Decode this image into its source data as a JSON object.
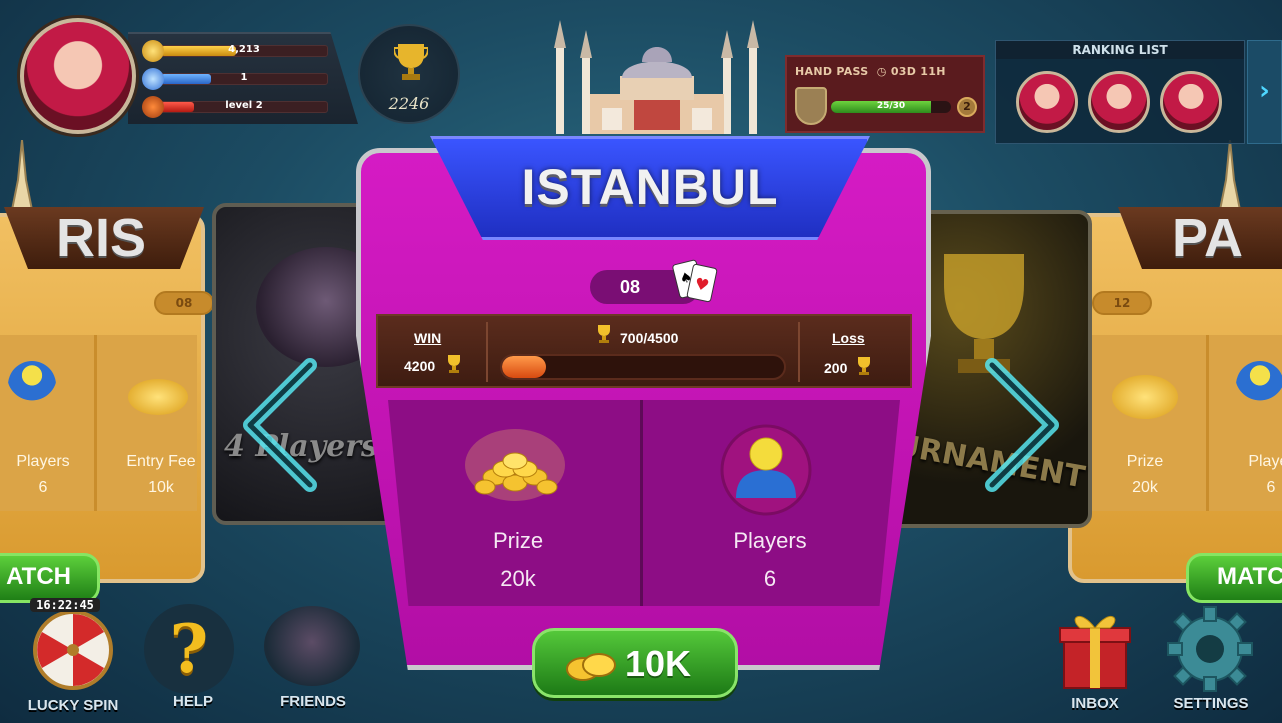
{
  "profile": {
    "coins": "4,213",
    "gems": "1",
    "level": "level 2",
    "coins_fill": 0.45,
    "gems_fill": 0.3,
    "level_fill": 0.2,
    "trophies": "2246"
  },
  "hand_pass": {
    "title": "HAND PASS",
    "timer": "03D 11H",
    "progress_text": "25/30",
    "progress_fraction": 0.83,
    "level": "2"
  },
  "ranking": {
    "title": "RANKING LIST",
    "next_icon": "›"
  },
  "left_card": {
    "banner_text": "RIS",
    "count": "08",
    "players_label": "Players",
    "players_value": "6",
    "entry_fee_label": "Entry Fee",
    "entry_fee_value": "10k",
    "match_label": "ATCH",
    "mode_text": "4 Players"
  },
  "right_card": {
    "banner_text": "PA",
    "count": "12",
    "prize_label": "Prize",
    "prize_value": "20k",
    "players_label": "Player",
    "players_value": "6",
    "match_label": "MATC",
    "mode_text": "URNAMENT"
  },
  "modal": {
    "title": "ISTANBUL",
    "count": "08",
    "win_label": "WIN",
    "win_value": "4200",
    "progress_text": "700/4500",
    "progress_fraction": 0.155,
    "loss_label": "Loss",
    "loss_value": "200",
    "prize_label": "Prize",
    "prize_value": "20k",
    "players_label": "Players",
    "players_value": "6",
    "join_label": "10K"
  },
  "bottom_nav": {
    "lucky_spin": "LUCKY SPIN",
    "lucky_spin_timer": "16:22:45",
    "help": "HELP",
    "friends": "FRIENDS",
    "inbox": "INBOX",
    "settings": "SETTINGS"
  },
  "colors": {
    "modal_magenta": "#c416b6",
    "title_blue": "#2a3fe0",
    "join_green": "#3aa82a",
    "card_gold": "#e6ad45"
  }
}
